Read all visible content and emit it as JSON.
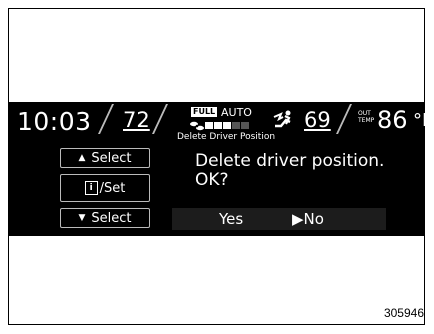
{
  "status": {
    "clock": "10:03",
    "driver_temp": "72",
    "fan_mode": "FULL",
    "climate_mode": "AUTO",
    "passenger_temp": "69",
    "outside_label_line1": "OUT",
    "outside_label_line2": "TEMP",
    "outside_temp": "86",
    "outside_unit": "°F",
    "fan_level": 0.6
  },
  "screen": {
    "title": "Delete Driver Position",
    "message_line1": "Delete driver position.",
    "message_line2": "OK?",
    "yes_label": "Yes",
    "no_label": "No",
    "selected_answer": "No",
    "selector_glyph": "▶"
  },
  "buttons": {
    "up": {
      "label": "Select",
      "glyph": "▲"
    },
    "set": {
      "label": "/Set",
      "glyph": "i"
    },
    "down": {
      "label": "Select",
      "glyph": "▼"
    }
  },
  "figure_number": "305946",
  "icons": [
    "fan-icon",
    "seat-airflow-icon",
    "up-triangle-icon",
    "info-icon",
    "down-triangle-icon",
    "pointer-arrow-icon"
  ]
}
